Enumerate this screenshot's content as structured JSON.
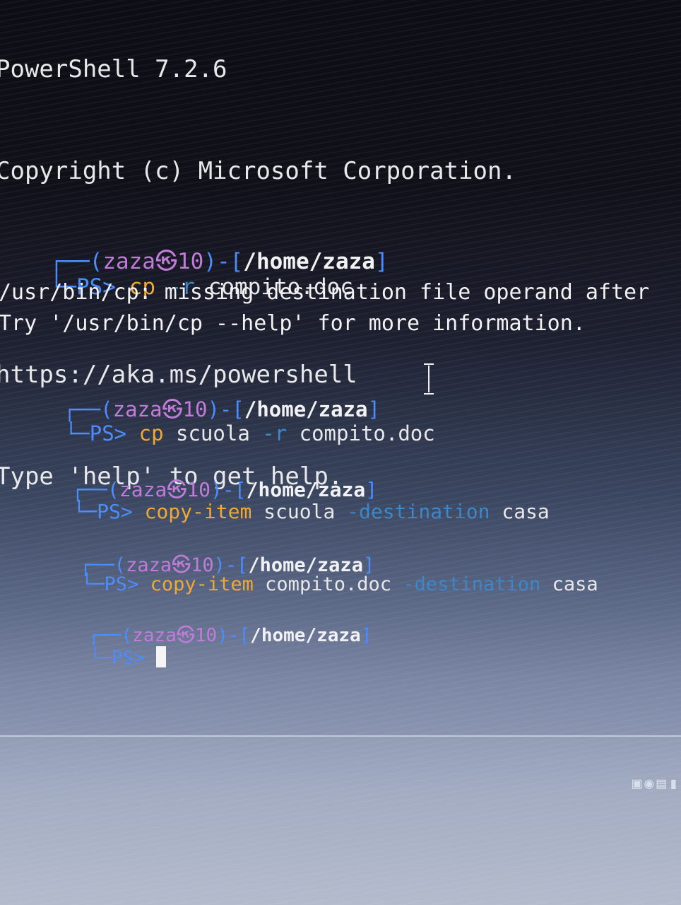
{
  "banner": {
    "line1": "PowerShell 7.2.6",
    "line2": "Copyright (c) Microsoft Corporation.",
    "line3": "https://aka.ms/powershell",
    "line4": "Type 'help' to get help."
  },
  "prompt": {
    "user": "zaza",
    "skull": "㉿",
    "host": "10",
    "path": "/home/zaza",
    "ps": "PS>"
  },
  "entries": [
    {
      "cmd": "cp",
      "parts": [
        "-r",
        "compito.doc"
      ]
    },
    {
      "cmd": "cp",
      "parts": [
        "scuola",
        "-r",
        "compito.doc"
      ]
    },
    {
      "cmd": "copy-item",
      "parts": [
        "scuola",
        "-destination",
        "casa"
      ]
    },
    {
      "cmd": "copy-item",
      "parts": [
        "compito.doc",
        "-destination",
        "casa"
      ]
    }
  ],
  "errors": {
    "line1": "/usr/bin/cp: missing destination file operand after",
    "line2": "Try '/usr/bin/cp --help' for more information."
  },
  "colors": {
    "prompt_blue": "#4a8cff",
    "user_purple": "#c07ad8",
    "command_orange": "#f0a830",
    "flag_blue": "#3a86c8",
    "text": "#e8e8ea"
  },
  "icons": [
    "text-cursor-icon",
    "tray-icons"
  ]
}
